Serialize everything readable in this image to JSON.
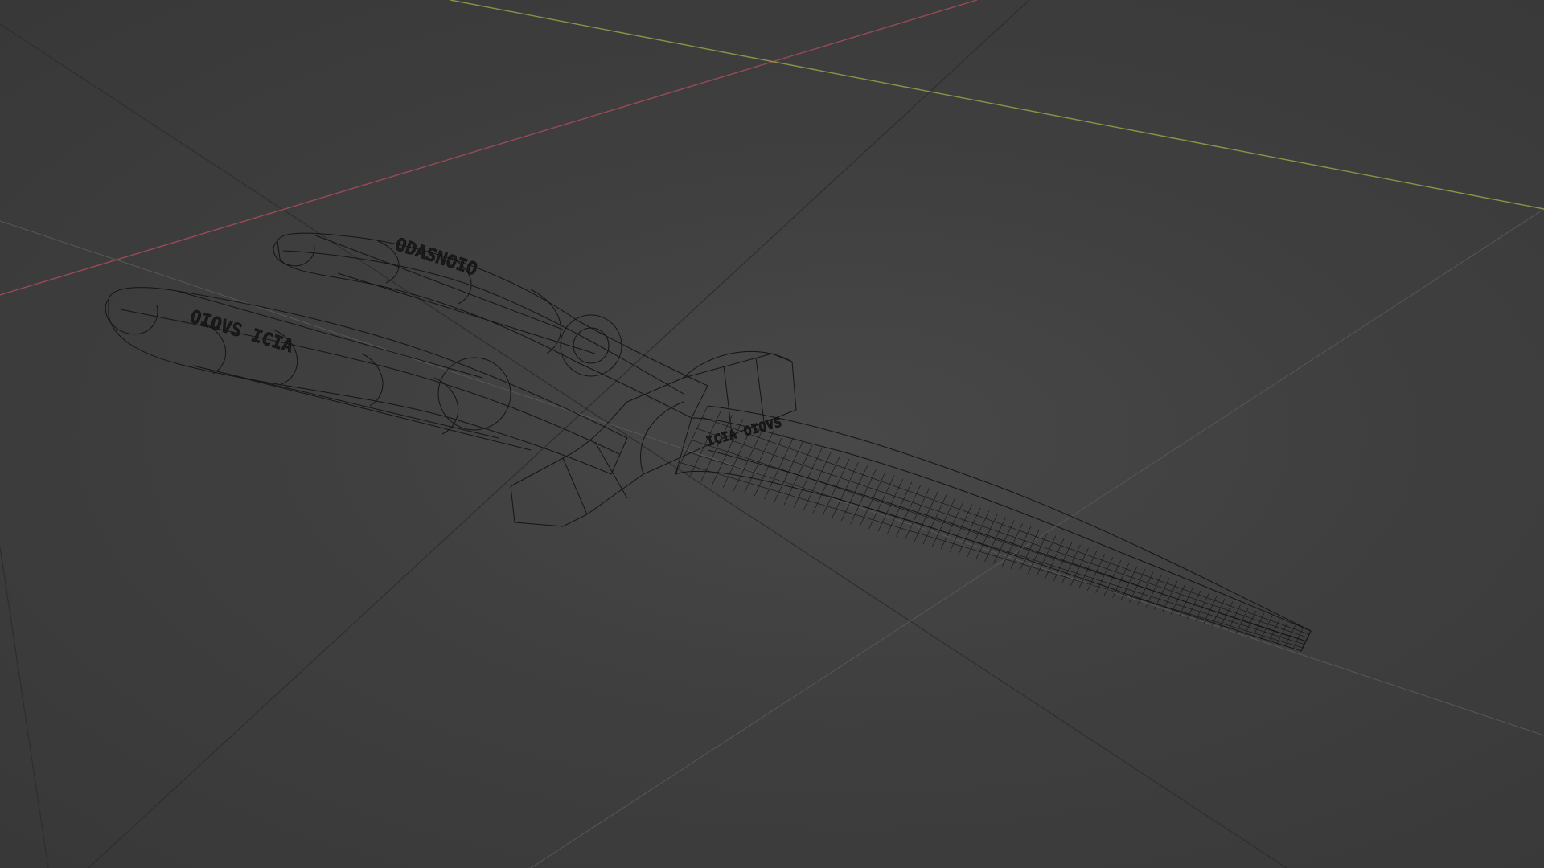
{
  "viewport": {
    "background": "#3d3d3d",
    "shading_mode": "wireframe",
    "colors": {
      "grid_line": "#2c2c2c",
      "grid_line_faint": "#555555",
      "x_axis": "#9a4a57",
      "y_axis": "#8a9445",
      "wire": "#141414"
    }
  },
  "model": {
    "name": "pliers",
    "engravings": {
      "upper_handle": "ODASNOIO",
      "lower_handle": "OIOVS ICIA",
      "jaw": "ICIA OIOVS"
    }
  }
}
